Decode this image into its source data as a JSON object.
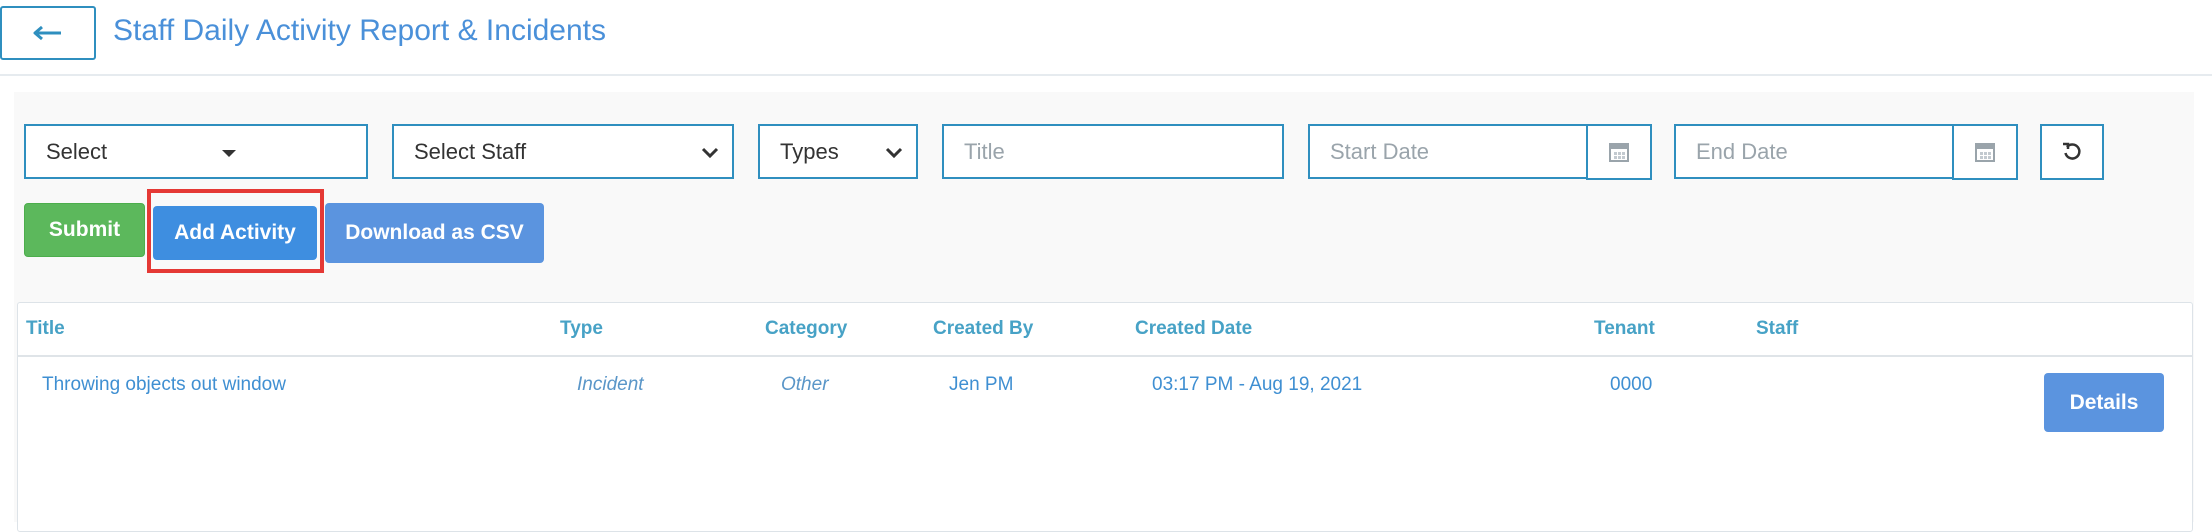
{
  "header": {
    "back_icon": "arrow-left-icon",
    "title": "Staff Daily Activity Report & Incidents"
  },
  "filters": {
    "select": {
      "value": "Select"
    },
    "staff": {
      "value": "Select Staff"
    },
    "types": {
      "value": "Types"
    },
    "title": {
      "placeholder": "Title"
    },
    "start_date": {
      "placeholder": "Start Date",
      "icon": "calendar-icon"
    },
    "end_date": {
      "placeholder": "End Date",
      "icon": "calendar-icon"
    },
    "reset_icon": "refresh-icon"
  },
  "actions": {
    "submit_label": "Submit",
    "add_activity_label": "Add Activity",
    "download_csv_label": "Download as CSV"
  },
  "table": {
    "columns": [
      "Title",
      "Type",
      "Category",
      "Created By",
      "Created Date",
      "Tenant",
      "Staff"
    ],
    "rows": [
      {
        "title": "Throwing objects out window",
        "type": "Incident",
        "category": "Other",
        "created_by": "Jen PM",
        "created_date": "03:17 PM - Aug 19, 2021",
        "tenant": "0000",
        "staff": "",
        "action_label": "Details"
      }
    ]
  },
  "colors": {
    "accent": "#4a90d9",
    "border": "#2f8fbf",
    "submit": "#5cb85c",
    "highlight": "#e53935"
  }
}
